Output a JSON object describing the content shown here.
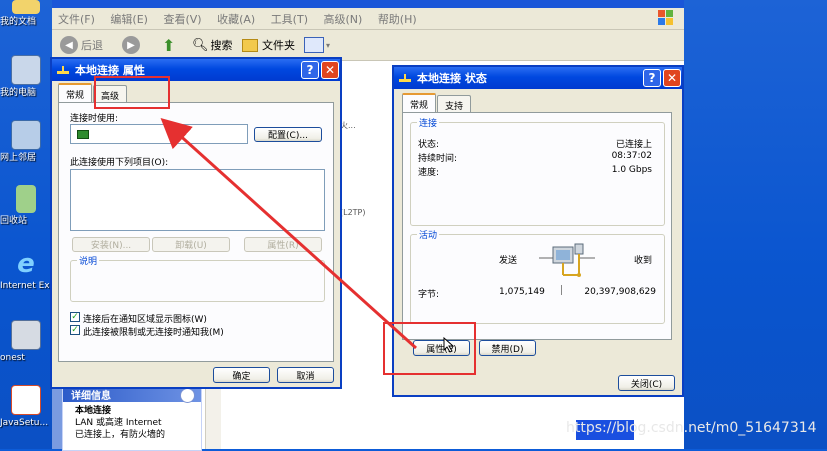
{
  "desktop": {
    "icons": [
      {
        "label": "我的文档",
        "icon": "my-documents-icon"
      },
      {
        "label": "我的电脑",
        "icon": "my-computer-icon"
      },
      {
        "label": "网上邻居",
        "icon": "network-places-icon"
      },
      {
        "label": "回收站",
        "icon": "recycle-bin-icon"
      },
      {
        "label": "Internet Explorer",
        "icon": "internet-explorer-icon"
      },
      {
        "label": "onest",
        "icon": "onest-icon"
      },
      {
        "label": "JavaSetu...",
        "icon": "java-setup-icon"
      }
    ]
  },
  "explorer": {
    "menu": [
      "文件(F)",
      "编辑(E)",
      "查看(V)",
      "收藏(A)",
      "工具(T)",
      "高级(N)",
      "帮助(H)"
    ],
    "toolbar": {
      "back": "后退",
      "search": "搜索",
      "folders": "文件夹"
    },
    "background_text": {
      "line1": "火...",
      "line2": "(L2TP)"
    },
    "detail_panel": {
      "title": "详细信息",
      "name": "本地连接",
      "line1": "LAN 或高速 Internet",
      "line2": "已连接上，有防火墙的"
    }
  },
  "properties_dialog": {
    "title": "本地连接 属性",
    "tabs": [
      "常规",
      "高级"
    ],
    "connect_using_label": "连接时使用:",
    "configure_button": "配置(C)...",
    "items_label": "此连接使用下列项目(O):",
    "install_button": "安装(N)...",
    "uninstall_button": "卸载(U)",
    "properties_button": "属性(R)",
    "description_label": "说明",
    "checkbox_show_icon": "连接后在通知区域显示图标(W)",
    "checkbox_notify": "此连接被限制或无连接时通知我(M)",
    "ok_button": "确定",
    "cancel_button": "取消"
  },
  "status_dialog": {
    "title": "本地连接 状态",
    "tabs": [
      "常规",
      "支持"
    ],
    "connection_group": "连接",
    "status_label": "状态:",
    "status_value": "已连接上",
    "duration_label": "持续时间:",
    "duration_value": "08:37:02",
    "speed_label": "速度:",
    "speed_value": "1.0 Gbps",
    "activity_group": "活动",
    "sent_label": "发送",
    "received_label": "收到",
    "bytes_label": "字节:",
    "bytes_sent": "1,075,149",
    "bytes_received": "20,397,908,629",
    "properties_button": "属性(P)",
    "disable_button": "禁用(D)",
    "close_button": "关闭(C)"
  },
  "watermark": "https://blog.csdn.net/m0_51647314",
  "annotation_color": "#e53030"
}
